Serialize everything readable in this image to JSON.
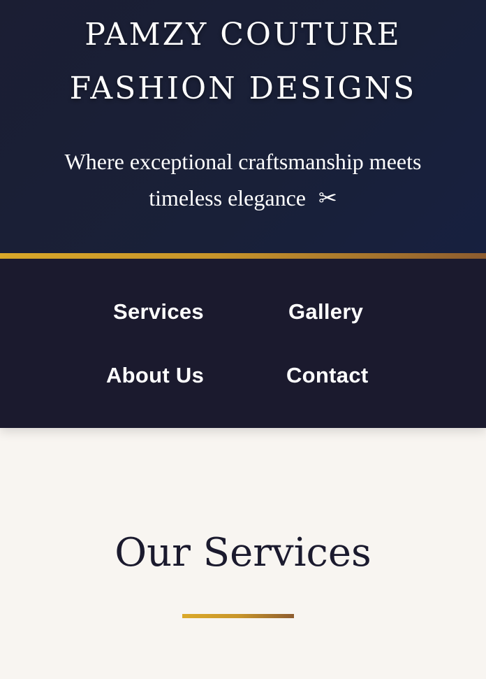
{
  "header": {
    "brand_line_1": "PAMZY COUTURE",
    "brand_line_2": "FASHION DESIGNS",
    "tagline_line_1": "Where exceptional craftsmanship meets",
    "tagline_line_2": "timeless elegance",
    "tagline_icon": "scissors-icon",
    "tagline_icon_glyph": "✂"
  },
  "nav": {
    "items": [
      {
        "label": "Services"
      },
      {
        "label": "Gallery"
      },
      {
        "label": "About Us"
      },
      {
        "label": "Contact"
      }
    ]
  },
  "main": {
    "section_title": "Our Services"
  },
  "colors": {
    "hero_bg": "#1b1e33",
    "nav_bg": "#1b1a2e",
    "gold_accent": "#dba92a",
    "bronze_accent": "#8e5d30",
    "page_bg": "#f8f5f1",
    "title_text": "#1b1a2e"
  }
}
